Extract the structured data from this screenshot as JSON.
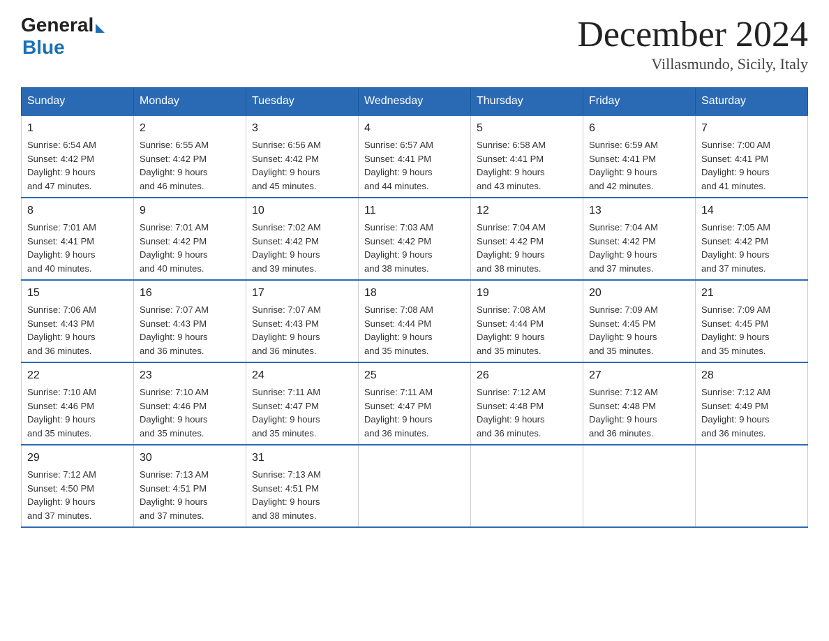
{
  "header": {
    "logo_general": "General",
    "logo_blue": "Blue",
    "month": "December 2024",
    "location": "Villasmundo, Sicily, Italy"
  },
  "days_of_week": [
    "Sunday",
    "Monday",
    "Tuesday",
    "Wednesday",
    "Thursday",
    "Friday",
    "Saturday"
  ],
  "weeks": [
    [
      {
        "day": "1",
        "sunrise": "6:54 AM",
        "sunset": "4:42 PM",
        "daylight": "9 hours and 47 minutes."
      },
      {
        "day": "2",
        "sunrise": "6:55 AM",
        "sunset": "4:42 PM",
        "daylight": "9 hours and 46 minutes."
      },
      {
        "day": "3",
        "sunrise": "6:56 AM",
        "sunset": "4:42 PM",
        "daylight": "9 hours and 45 minutes."
      },
      {
        "day": "4",
        "sunrise": "6:57 AM",
        "sunset": "4:41 PM",
        "daylight": "9 hours and 44 minutes."
      },
      {
        "day": "5",
        "sunrise": "6:58 AM",
        "sunset": "4:41 PM",
        "daylight": "9 hours and 43 minutes."
      },
      {
        "day": "6",
        "sunrise": "6:59 AM",
        "sunset": "4:41 PM",
        "daylight": "9 hours and 42 minutes."
      },
      {
        "day": "7",
        "sunrise": "7:00 AM",
        "sunset": "4:41 PM",
        "daylight": "9 hours and 41 minutes."
      }
    ],
    [
      {
        "day": "8",
        "sunrise": "7:01 AM",
        "sunset": "4:41 PM",
        "daylight": "9 hours and 40 minutes."
      },
      {
        "day": "9",
        "sunrise": "7:01 AM",
        "sunset": "4:42 PM",
        "daylight": "9 hours and 40 minutes."
      },
      {
        "day": "10",
        "sunrise": "7:02 AM",
        "sunset": "4:42 PM",
        "daylight": "9 hours and 39 minutes."
      },
      {
        "day": "11",
        "sunrise": "7:03 AM",
        "sunset": "4:42 PM",
        "daylight": "9 hours and 38 minutes."
      },
      {
        "day": "12",
        "sunrise": "7:04 AM",
        "sunset": "4:42 PM",
        "daylight": "9 hours and 38 minutes."
      },
      {
        "day": "13",
        "sunrise": "7:04 AM",
        "sunset": "4:42 PM",
        "daylight": "9 hours and 37 minutes."
      },
      {
        "day": "14",
        "sunrise": "7:05 AM",
        "sunset": "4:42 PM",
        "daylight": "9 hours and 37 minutes."
      }
    ],
    [
      {
        "day": "15",
        "sunrise": "7:06 AM",
        "sunset": "4:43 PM",
        "daylight": "9 hours and 36 minutes."
      },
      {
        "day": "16",
        "sunrise": "7:07 AM",
        "sunset": "4:43 PM",
        "daylight": "9 hours and 36 minutes."
      },
      {
        "day": "17",
        "sunrise": "7:07 AM",
        "sunset": "4:43 PM",
        "daylight": "9 hours and 36 minutes."
      },
      {
        "day": "18",
        "sunrise": "7:08 AM",
        "sunset": "4:44 PM",
        "daylight": "9 hours and 35 minutes."
      },
      {
        "day": "19",
        "sunrise": "7:08 AM",
        "sunset": "4:44 PM",
        "daylight": "9 hours and 35 minutes."
      },
      {
        "day": "20",
        "sunrise": "7:09 AM",
        "sunset": "4:45 PM",
        "daylight": "9 hours and 35 minutes."
      },
      {
        "day": "21",
        "sunrise": "7:09 AM",
        "sunset": "4:45 PM",
        "daylight": "9 hours and 35 minutes."
      }
    ],
    [
      {
        "day": "22",
        "sunrise": "7:10 AM",
        "sunset": "4:46 PM",
        "daylight": "9 hours and 35 minutes."
      },
      {
        "day": "23",
        "sunrise": "7:10 AM",
        "sunset": "4:46 PM",
        "daylight": "9 hours and 35 minutes."
      },
      {
        "day": "24",
        "sunrise": "7:11 AM",
        "sunset": "4:47 PM",
        "daylight": "9 hours and 35 minutes."
      },
      {
        "day": "25",
        "sunrise": "7:11 AM",
        "sunset": "4:47 PM",
        "daylight": "9 hours and 36 minutes."
      },
      {
        "day": "26",
        "sunrise": "7:12 AM",
        "sunset": "4:48 PM",
        "daylight": "9 hours and 36 minutes."
      },
      {
        "day": "27",
        "sunrise": "7:12 AM",
        "sunset": "4:48 PM",
        "daylight": "9 hours and 36 minutes."
      },
      {
        "day": "28",
        "sunrise": "7:12 AM",
        "sunset": "4:49 PM",
        "daylight": "9 hours and 36 minutes."
      }
    ],
    [
      {
        "day": "29",
        "sunrise": "7:12 AM",
        "sunset": "4:50 PM",
        "daylight": "9 hours and 37 minutes."
      },
      {
        "day": "30",
        "sunrise": "7:13 AM",
        "sunset": "4:51 PM",
        "daylight": "9 hours and 37 minutes."
      },
      {
        "day": "31",
        "sunrise": "7:13 AM",
        "sunset": "4:51 PM",
        "daylight": "9 hours and 38 minutes."
      },
      null,
      null,
      null,
      null
    ]
  ],
  "labels": {
    "sunrise": "Sunrise: ",
    "sunset": "Sunset: ",
    "daylight": "Daylight: "
  }
}
